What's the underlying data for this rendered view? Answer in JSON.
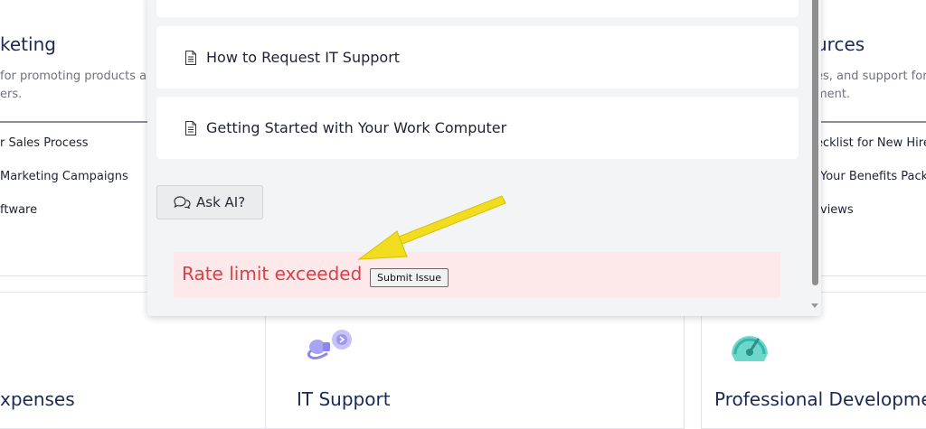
{
  "background": {
    "left_card": {
      "title": "keting",
      "description_lines": [
        "for promoting products and",
        "ers."
      ],
      "links": [
        "r Sales Process",
        "Marketing Campaigns",
        "ftware"
      ]
    },
    "right_card": {
      "title": "urces",
      "description_lines": [
        "es, and support for e",
        "ment."
      ],
      "links": [
        "ecklist for New Hire",
        "Your Benefits Packa",
        "views"
      ]
    },
    "bottom_cards": {
      "left_title": "xpenses",
      "middle_title": "IT Support",
      "right_title": "Professional Developmen"
    },
    "icons": {
      "it_support": "plug-icon",
      "professional_development": "gauge-icon"
    }
  },
  "modal": {
    "articles": [
      {
        "label": "",
        "icon": "document-icon"
      },
      {
        "label": "How to Request IT Support",
        "icon": "document-icon"
      },
      {
        "label": "Getting Started with Your Work Computer",
        "icon": "document-icon"
      }
    ],
    "ask_ai": {
      "label": "Ask AI?",
      "icon": "chat-bubbles-icon"
    },
    "error": {
      "message": "Rate limit exceeded",
      "submit_label": "Submit Issue"
    }
  },
  "colors": {
    "error_text": "#d94048",
    "error_background": "#fde8ea",
    "annotation_arrow": "#f2dc1e",
    "title_navy": "#1b2a55"
  },
  "annotation": {
    "icon": "yellow-arrow-icon"
  }
}
